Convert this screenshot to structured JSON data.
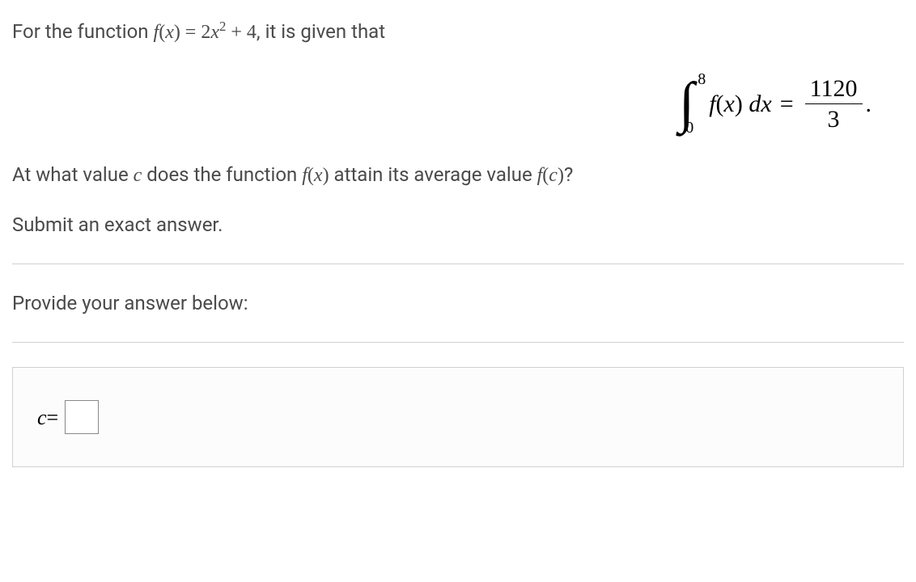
{
  "problem": {
    "intro_prefix": "For the function ",
    "func_def_f": "f",
    "func_def_x": "(x)",
    "equals": " = ",
    "func_def_coeff": "2",
    "func_def_var": "x",
    "func_def_exp": "2",
    "func_def_plus": " + 4",
    "intro_suffix": ", it is given that"
  },
  "integral": {
    "lower": "0",
    "upper": "8",
    "integrand_f": "f",
    "integrand_paren_open": "(",
    "integrand_x": "x",
    "integrand_paren_close": ")",
    "dx_d": " d",
    "dx_x": "x",
    "equals": " = ",
    "result_num": "1120",
    "result_den": "3",
    "period": "."
  },
  "question": {
    "prefix": "At what value ",
    "var_c": "c",
    "mid1": " does the function ",
    "fx_f": "f",
    "fx_x": "(x)",
    "mid2": " attain its average value ",
    "fc_f": "f",
    "fc_c": "(c)",
    "suffix": "?"
  },
  "instruction": "Submit an exact answer.",
  "prompt": "Provide your answer below:",
  "answer": {
    "var": "c",
    "equals": " = "
  }
}
